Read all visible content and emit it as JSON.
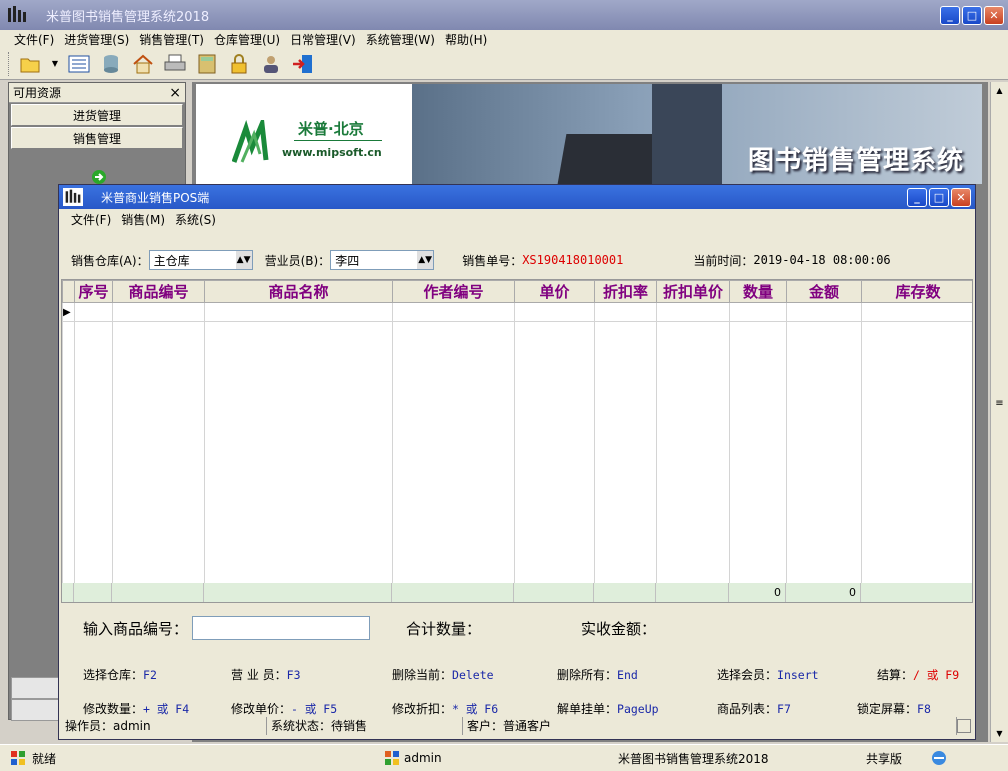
{
  "app": {
    "title": "米普图书销售管理系统2018"
  },
  "menu": [
    "文件(F)",
    "进货管理(S)",
    "销售管理(T)",
    "仓库管理(U)",
    "日常管理(V)",
    "系统管理(W)",
    "帮助(H)"
  ],
  "toolbar_icons": [
    "open-folder-icon",
    "list-icon",
    "database-icon",
    "home-icon",
    "printer-icon",
    "calculator-icon",
    "lock-icon",
    "user-icon",
    "exit-icon"
  ],
  "sidebar": {
    "title": "可用资源",
    "close": "×",
    "items": [
      "进货管理",
      "销售管理"
    ]
  },
  "banner": {
    "logo_text": "米普·北京",
    "logo_url": "www.mipsoft.cn",
    "title": "图书销售管理系统"
  },
  "pos": {
    "title": "米普商业销售POS端",
    "menu": [
      "文件(F)",
      "销售(M)",
      "系统(S)"
    ],
    "warehouse_label": "销售仓库(A)：",
    "warehouse_value": "主仓库",
    "clerk_label": "营业员(B)：",
    "clerk_value": "李四",
    "order_label": "销售单号：",
    "order_value": "XS190418010001",
    "time_label": "当前时间：",
    "time_value": "2019-04-18 08:00:06",
    "columns": [
      "序号",
      "商品编号",
      "商品名称",
      "作者编号",
      "单价",
      "折扣率",
      "折扣单价",
      "数量",
      "金额",
      "库存数"
    ],
    "sum_qty": "0",
    "sum_amount": "0",
    "input_label": "输入商品编号：",
    "total_qty_label": "合计数量：",
    "paid_label": "实收金额：",
    "hotkeys_row1": [
      {
        "label": "选择仓库：",
        "key": "F2"
      },
      {
        "label": "营 业 员：",
        "key": "F3"
      },
      {
        "label": "删除当前：",
        "key": "Delete"
      },
      {
        "label": "删除所有：",
        "key": "End"
      },
      {
        "label": "选择会员：",
        "key": "Insert"
      },
      {
        "label": "结算：",
        "key": "/ 或 F9"
      }
    ],
    "hotkeys_row2": [
      {
        "label": "修改数量：",
        "key": "+ 或 F4"
      },
      {
        "label": "修改单价：",
        "key": "- 或 F5"
      },
      {
        "label": "修改折扣：",
        "key": "* 或 F6"
      },
      {
        "label": "解单挂单：",
        "key": "PageUp"
      },
      {
        "label": "商品列表：",
        "key": "F7"
      },
      {
        "label": "锁定屏幕：",
        "key": "F8"
      }
    ],
    "status": {
      "operator": "操作员：admin",
      "state": "系统状态：待销售",
      "customer": "客户：普通客户"
    }
  },
  "statusbar": {
    "ready": "就绪",
    "user": "admin",
    "app": "米普图书销售管理系统2018",
    "edition": "共享版"
  },
  "colors": {
    "title_blue": "#2858c8",
    "header_purple": "#800080",
    "key_blue": "#1a28a8",
    "red": "#dd0000"
  }
}
